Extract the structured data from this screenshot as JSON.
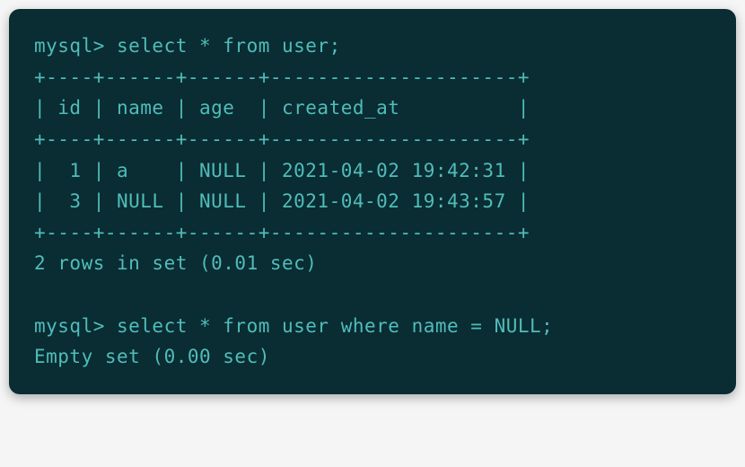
{
  "terminal": {
    "prompt1": "mysql> select * from user;",
    "divider_top": "+----+------+------+---------------------+",
    "header": "| id | name | age  | created_at          |",
    "divider_mid": "+----+------+------+---------------------+",
    "row1": "|  1 | a    | NULL | 2021-04-02 19:42:31 |",
    "row2": "|  3 | NULL | NULL | 2021-04-02 19:43:57 |",
    "divider_bot": "+----+------+------+---------------------+",
    "result1": "2 rows in set (0.01 sec)",
    "prompt2": "mysql> select * from user where name = NULL;",
    "result2": "Empty set (0.00 sec)"
  },
  "table_data": {
    "columns": [
      "id",
      "name",
      "age",
      "created_at"
    ],
    "rows": [
      {
        "id": 1,
        "name": "a",
        "age": null,
        "created_at": "2021-04-02 19:42:31"
      },
      {
        "id": 3,
        "name": null,
        "age": null,
        "created_at": "2021-04-02 19:43:57"
      }
    ]
  }
}
